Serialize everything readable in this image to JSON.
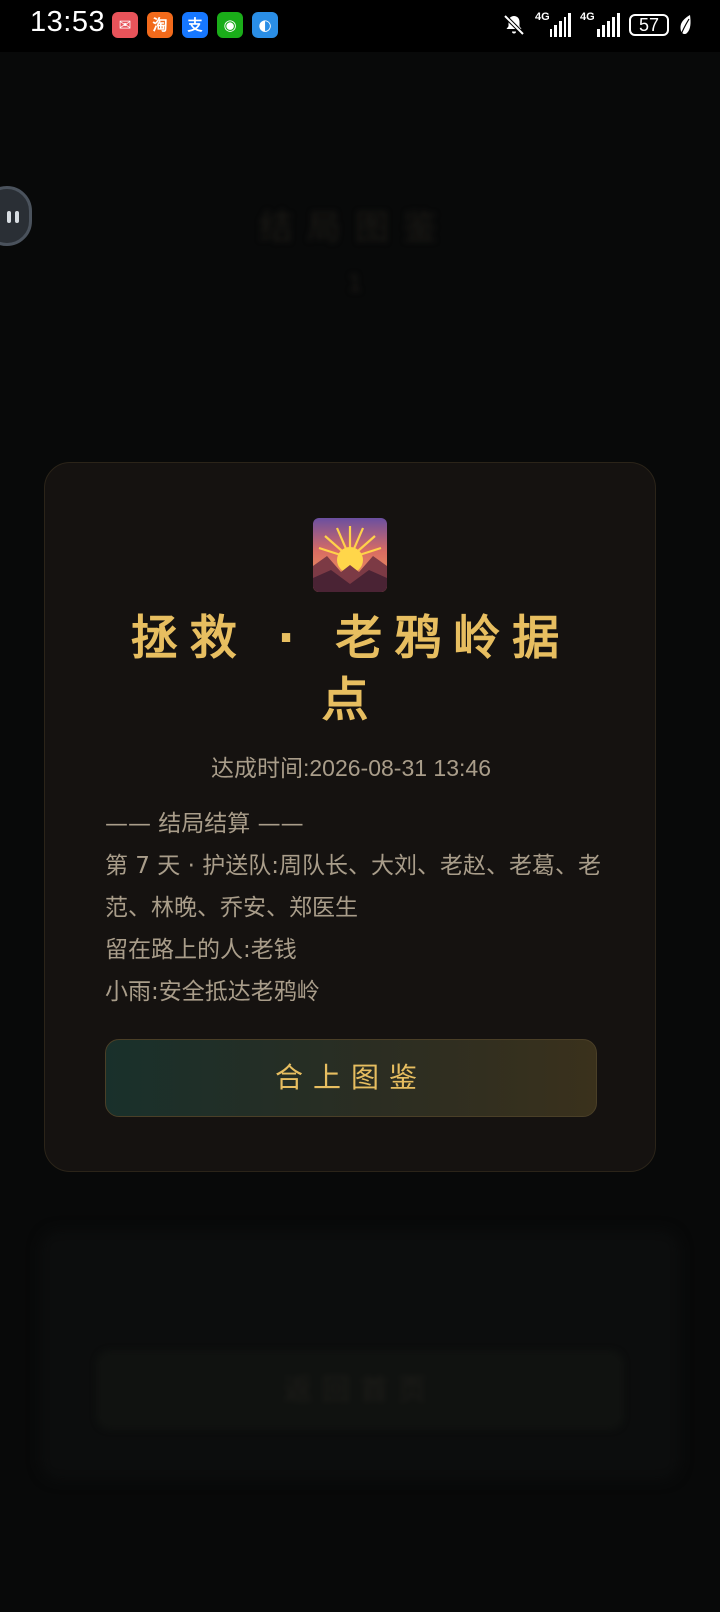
{
  "status_bar": {
    "time": "13:53",
    "apps": [
      {
        "icon": "mail-icon",
        "color": "#e8535a",
        "glyph": "✉"
      },
      {
        "icon": "taobao-icon",
        "color": "#f26a1b",
        "glyph": "淘"
      },
      {
        "icon": "alipay-icon",
        "color": "#1677ff",
        "glyph": "支"
      },
      {
        "icon": "wechat-icon",
        "color": "#1aad19",
        "glyph": "◉"
      },
      {
        "icon": "browser-icon",
        "color": "#2a8ee6",
        "glyph": "◐"
      }
    ],
    "signal_1": "4G",
    "signal_2": "4G",
    "battery": "57"
  },
  "background": {
    "title": "结局图鉴",
    "subtitle": "1",
    "button": "返回首页"
  },
  "card": {
    "emblem_icon": "sunrise-over-mountains-icon",
    "title": "拯救 · 老鸦岭据点",
    "achieved_label": "达成时间:",
    "achieved_time": "2026-08-31 13:46",
    "summary_header": "—— 结局结算 ——",
    "summary_line1": "第 7 天 · 护送队:周队长、大刘、老赵、老葛、老范、林晚、乔安、郑医生",
    "summary_line2": "留在路上的人:老钱",
    "summary_line3": "小雨:安全抵达老鸦岭",
    "close_button": "合上图鉴"
  },
  "colors": {
    "accent": "#e7be60",
    "text": "#a99d8a",
    "card_bg": "#151210"
  }
}
